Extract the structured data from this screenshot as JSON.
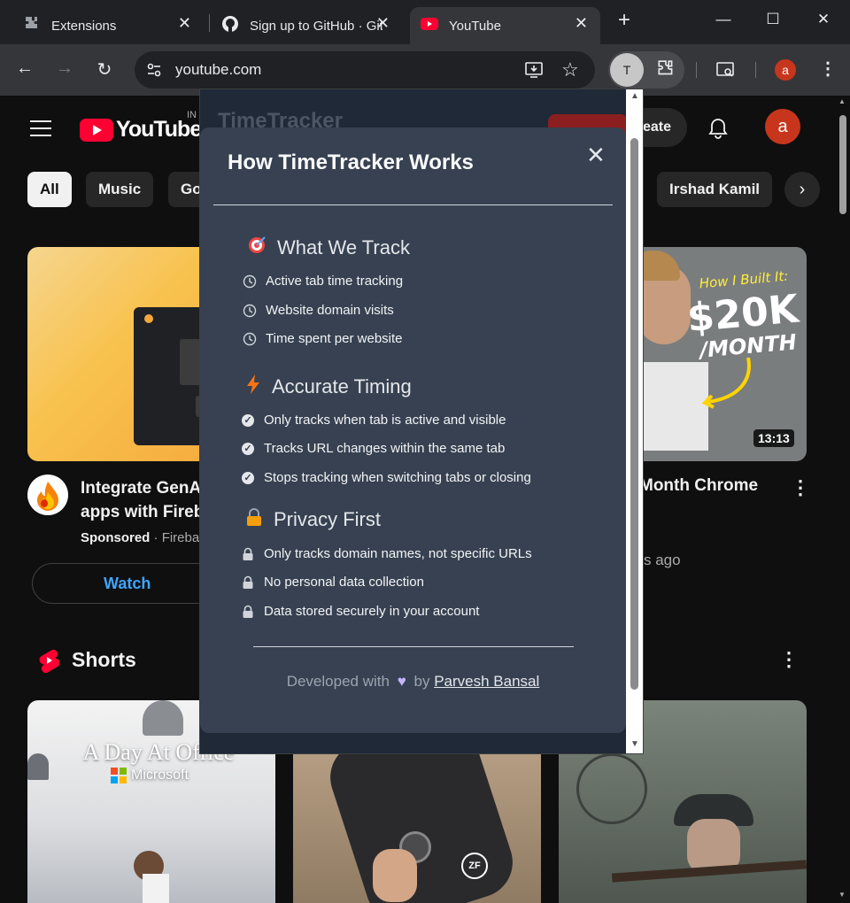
{
  "browser": {
    "tabs": [
      {
        "title": "Extensions",
        "icon": "puzzle-icon"
      },
      {
        "title": "Sign up to GitHub · GitHub",
        "icon": "github-icon"
      },
      {
        "title": "YouTube",
        "icon": "youtube-icon"
      }
    ],
    "new_tab": "+",
    "url": "youtube.com",
    "extension_badge": "T",
    "profile_initial": "a"
  },
  "youtube": {
    "logo_text": "YouTube",
    "region": "IN",
    "create_label": "Create",
    "avatar_initial": "a",
    "chips": [
      "All",
      "Music",
      "Go",
      "Irshad Kamil"
    ],
    "videos": [
      {
        "title_line1": "Integrate GenAI",
        "title_line2": "apps with Fireba",
        "sponsored": "Sponsored",
        "channel": "Fireba",
        "action": "Watch"
      },
      {
        "title_line1": "Month Chrome",
        "meta": "s ago",
        "duration": "13:13",
        "thumb_line1": "How I Built It:",
        "thumb_line2": "$20K",
        "thumb_line3": "/MONTH"
      }
    ],
    "shorts_label": "Shorts",
    "short1_title": "A Day At Office",
    "short1_brand": "Microsoft",
    "short2_badge": "ZF"
  },
  "popup": {
    "header": "TimeTracker",
    "modal_title": "How TimeTracker Works",
    "sections": [
      {
        "title": "What We Track",
        "icon": "target-icon",
        "items": [
          "Active tab time tracking",
          "Website domain visits",
          "Time spent per website"
        ]
      },
      {
        "title": "Accurate Timing",
        "icon": "lightning-icon",
        "items": [
          "Only tracks when tab is active and visible",
          "Tracks URL changes within the same tab",
          "Stops tracking when switching tabs or closing"
        ]
      },
      {
        "title": "Privacy First",
        "icon": "lock-icon",
        "items": [
          "Only tracks domain names, not specific URLs",
          "No personal data collection",
          "Data stored securely in your account"
        ]
      }
    ],
    "footer_prefix": "Developed with",
    "footer_by": "by",
    "footer_author": "Parvesh Bansal"
  }
}
